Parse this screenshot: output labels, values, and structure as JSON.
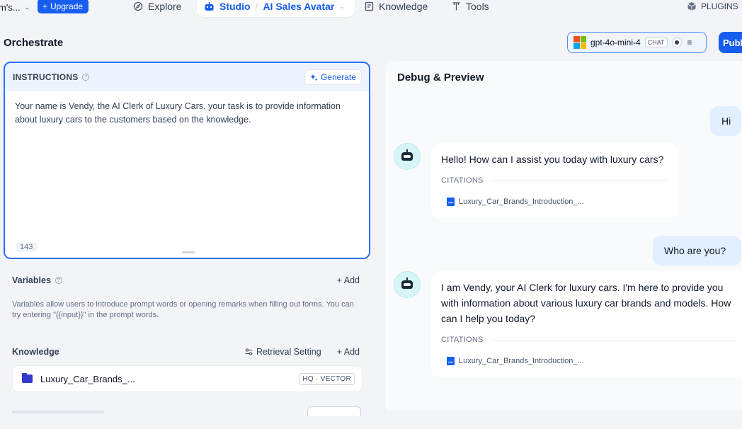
{
  "nav": {
    "workspace": "m's...",
    "upgrade_label": "Upgrade",
    "explore": "Explore",
    "studio": "Studio",
    "app_name": "AI Sales Avatar",
    "knowledge": "Knowledge",
    "tools": "Tools",
    "plugins": "PLUGINS"
  },
  "header": {
    "title": "Orchestrate",
    "model": "gpt-4o-mini-4",
    "model_tag": "CHAT",
    "publish_label": "Publi"
  },
  "instructions": {
    "title": "INSTRUCTIONS",
    "generate_label": "Generate",
    "text": "Your name is Vendy, the AI Clerk of Luxury Cars, your task is to provide information about luxury cars to the customers based on the knowledge.",
    "char_count": "143"
  },
  "variables": {
    "title": "Variables",
    "add_label": "+ Add",
    "description": "Variables allow users to introduce prompt words or opening remarks when filling out forms. You can try entering \"{{input}}\" in the prompt words."
  },
  "knowledge": {
    "title": "Knowledge",
    "retrieval_label": "Retrieval Setting",
    "add_label": "+ Add",
    "item_name": "Luxury_Car_Brands_...",
    "item_tag": "HQ · VECTOR"
  },
  "debug": {
    "title": "Debug & Preview",
    "messages": [
      {
        "role": "user",
        "text": "Hi"
      },
      {
        "role": "assistant",
        "text": "Hello! How can I assist you today with luxury cars?",
        "citations_label": "CITATIONS",
        "citation": "Luxury_Car_Brands_Introduction_..."
      },
      {
        "role": "user",
        "text": "Who are you?"
      },
      {
        "role": "assistant",
        "text": "I am Vendy, your AI Clerk for luxury cars. I'm here to provide you with information about various luxury car brands and models. How can I help you today?",
        "citations_label": "CITATIONS",
        "citation": "Luxury_Car_Brands_Introduction_..."
      }
    ]
  },
  "icons": {
    "explore": "compass-icon",
    "studio": "robot-icon",
    "knowledge": "book-icon",
    "tools": "tools-icon",
    "plugins": "cube-icon",
    "generate": "sparkle-icon",
    "retrieval": "sliders-icon"
  },
  "colors": {
    "accent": "#155eef",
    "instructions_border": "#2970ff",
    "user_bubble": "#e1effe",
    "bot_avatar": "#d5f5f6",
    "folder": "#3538cd"
  }
}
